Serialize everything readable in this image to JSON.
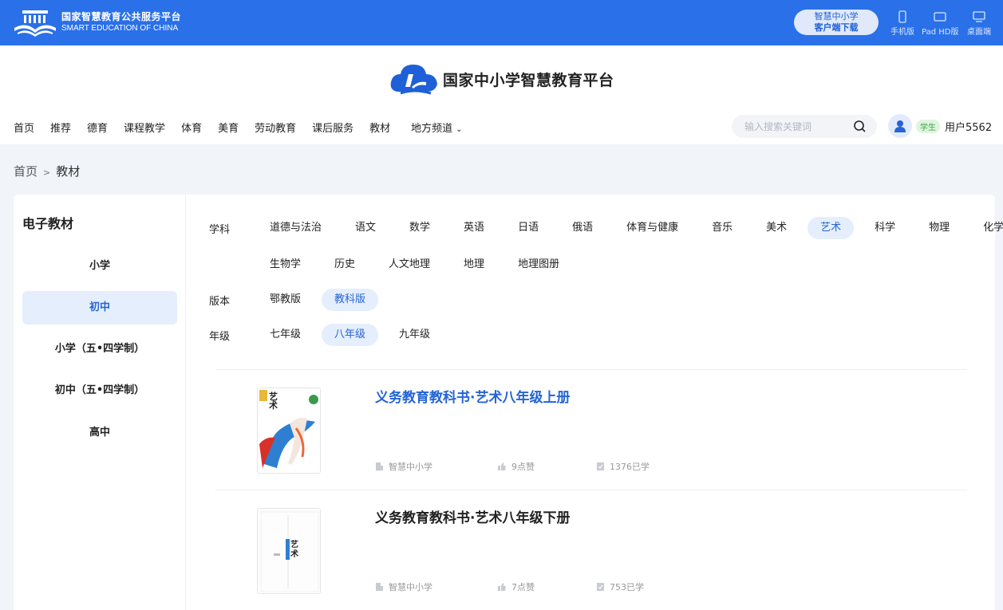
{
  "topbar": {
    "brand_cn": "国家智慧教育公共服务平台",
    "brand_en": "SMART EDUCATION OF CHINA",
    "client_line1": "智慧中小学",
    "client_line2": "客户端下载",
    "devices": [
      {
        "label": "手机版",
        "icon": "phone-icon"
      },
      {
        "label": "Pad HD版",
        "icon": "tablet-icon"
      },
      {
        "label": "桌面端",
        "icon": "desktop-icon"
      }
    ]
  },
  "header": {
    "site_title": "国家中小学智慧教育平台",
    "nav": [
      "首页",
      "推荐",
      "德育",
      "课程教学",
      "体育",
      "美育",
      "劳动教育",
      "课后服务",
      "教材",
      "地方频道"
    ],
    "search_placeholder": "输入搜索关键词",
    "user_role": "学生",
    "user_name": "用户5562"
  },
  "breadcrumb": {
    "home": "首页",
    "sep": ">",
    "current": "教材"
  },
  "sidebar": {
    "title": "电子教材",
    "items": [
      "小学",
      "初中",
      "小学（五•四学制）",
      "初中（五•四学制）",
      "高中"
    ],
    "active_index": 1
  },
  "filters": {
    "subject_label": "学科",
    "subjects_row1": [
      "道德与法治",
      "语文",
      "数学",
      "英语",
      "日语",
      "俄语",
      "体育与健康",
      "音乐",
      "美术",
      "艺术",
      "科学",
      "物理",
      "化学"
    ],
    "subjects_row2": [
      "生物学",
      "历史",
      "人文地理",
      "地理",
      "地理图册"
    ],
    "subject_active": "艺术",
    "edition_label": "版本",
    "editions": [
      "鄂教版",
      "教科版"
    ],
    "edition_active": "教科版",
    "grade_label": "年级",
    "grades": [
      "七年级",
      "八年级",
      "九年级"
    ],
    "grade_active": "八年级"
  },
  "books": [
    {
      "title": "义务教育教科书·艺术八年级上册",
      "publisher": "智慧中小学",
      "likes": "9点赞",
      "learners": "1376已学"
    },
    {
      "title": "义务教育教科书·艺术八年级下册",
      "publisher": "智慧中小学",
      "likes": "7点赞",
      "learners": "753已学"
    }
  ],
  "colors": {
    "brand_blue": "#2a70e8",
    "active_blue": "#2464d6",
    "active_bg": "#e5eefc"
  }
}
